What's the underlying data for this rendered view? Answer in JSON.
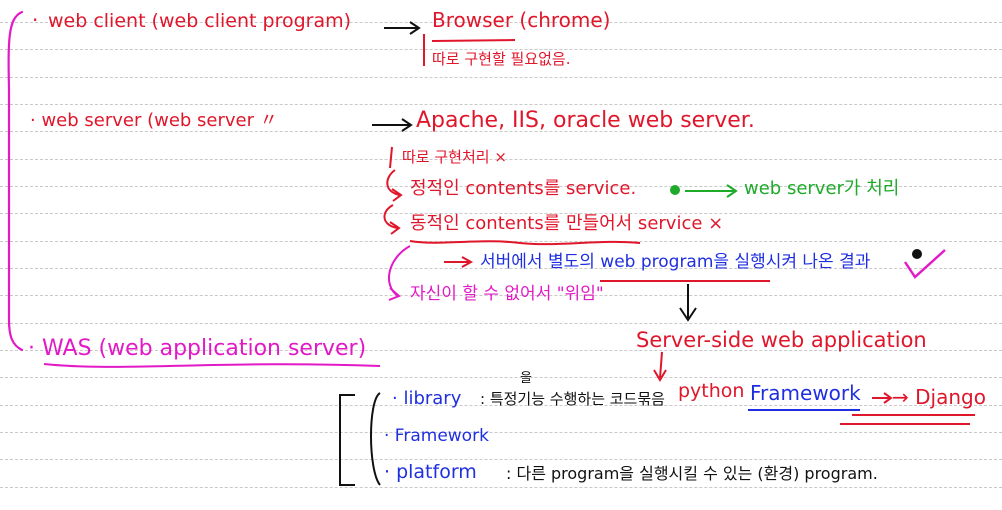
{
  "notes": {
    "bullet": "·",
    "web_client": "web client (web client program)",
    "browser": "Browser (chrome)",
    "browser_note": "따로 구현할 필요없음.",
    "web_server": "· web server (web server   〃",
    "apache": "Apache, IIS, oracle web server.",
    "separate_processing": "따로 구현처리 ×",
    "static_contents": "정적인 contents를 service.",
    "web_server_handles": "web server가 처리",
    "dynamic_contents": "동적인 contents를 만들어서 service ×",
    "execute_program": "서버에서 별도의 web program을 실행시켜 나온 결과",
    "cannot_self": "자신이 할 수 없어서 \"위임\"",
    "server_side": "Server-side web application",
    "was": "· WAS (web application server)",
    "library": "· library",
    "library_desc": ": 특정기능 수행하는 코드묶음",
    "library_desc_insert": "을",
    "python": "python",
    "framework_blue": "Framework",
    "django": "→ Django",
    "framework": "· Framework",
    "platform": "· platform",
    "platform_desc": ": 다른 program을 실행시킬 수 있는 (환경) program."
  }
}
